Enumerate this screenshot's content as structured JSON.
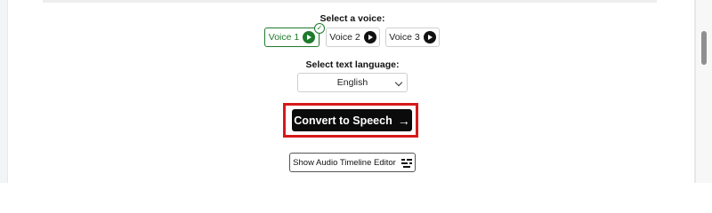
{
  "voice_section": {
    "heading": "Select a voice:",
    "voices": [
      {
        "label": "Voice 1",
        "selected": true
      },
      {
        "label": "Voice 2",
        "selected": false
      },
      {
        "label": "Voice 3",
        "selected": false
      }
    ]
  },
  "language_section": {
    "heading": "Select text language:",
    "selected_value": "English"
  },
  "actions": {
    "convert_label": "Convert to Speech",
    "timeline_label": "Show Audio Timeline Editor"
  },
  "colors": {
    "selected_green": "#1f7a2d",
    "highlight_red": "#d71919",
    "primary_button": "#0b0b0b"
  },
  "icons": {
    "play": "play-icon",
    "check": "check-icon",
    "arrow": "arrow-right-icon",
    "timeline": "timeline-icon"
  }
}
